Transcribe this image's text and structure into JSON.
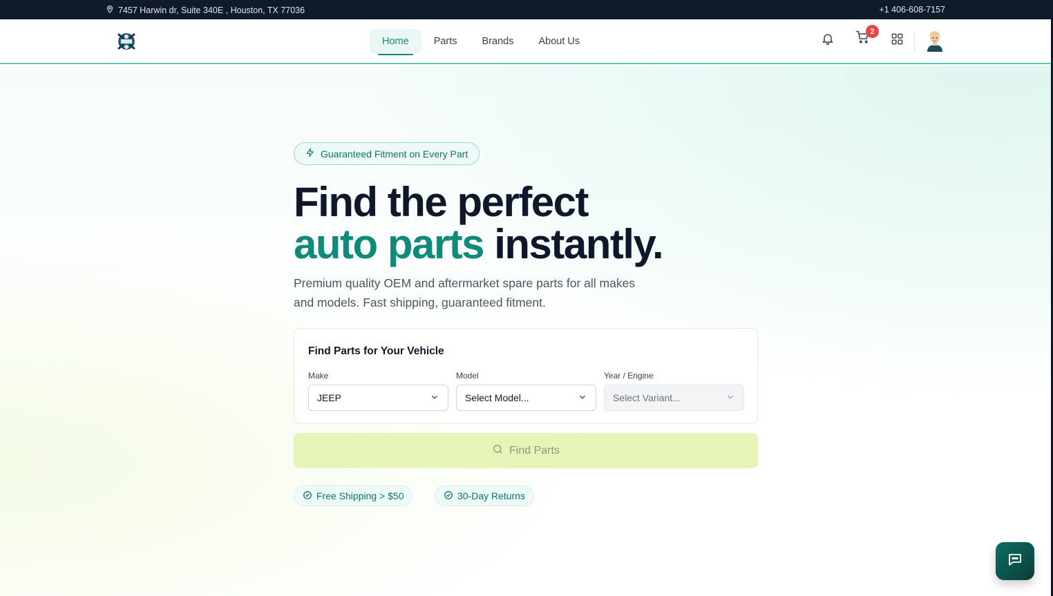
{
  "topbar": {
    "address": "7457 Harwin dr, Suite 340E , Houston, TX 77036",
    "phone": "+1 406-608-7157"
  },
  "nav": {
    "items": [
      {
        "label": "Home",
        "active": true
      },
      {
        "label": "Parts",
        "active": false
      },
      {
        "label": "Brands",
        "active": false
      },
      {
        "label": "About Us",
        "active": false
      }
    ],
    "cart_count": "2",
    "icons": [
      "bell-icon",
      "cart-icon",
      "grid-icon"
    ]
  },
  "hero": {
    "badge": "Guaranteed Fitment on Every Part",
    "headline_line1": "Find the perfect",
    "headline_accent": "auto parts",
    "headline_rest": " instantly.",
    "subtext": "Premium quality OEM and aftermarket spare parts for all makes and models. Fast shipping, guaranteed fitment."
  },
  "finder": {
    "title": "Find Parts for Your Vehicle",
    "make": {
      "label": "Make",
      "value": "JEEP"
    },
    "model": {
      "label": "Model",
      "value": "Select Model..."
    },
    "year": {
      "label": "Year / Engine",
      "value": "Select Variant..."
    },
    "button": "Find Parts"
  },
  "chips": [
    "Free Shipping > $50",
    "30-Day Returns"
  ],
  "colors": {
    "topbar": "#0f1a2a",
    "accent": "#0f8a7b",
    "button_disabled": "#e6f4b8",
    "badge": "#ef4444"
  }
}
